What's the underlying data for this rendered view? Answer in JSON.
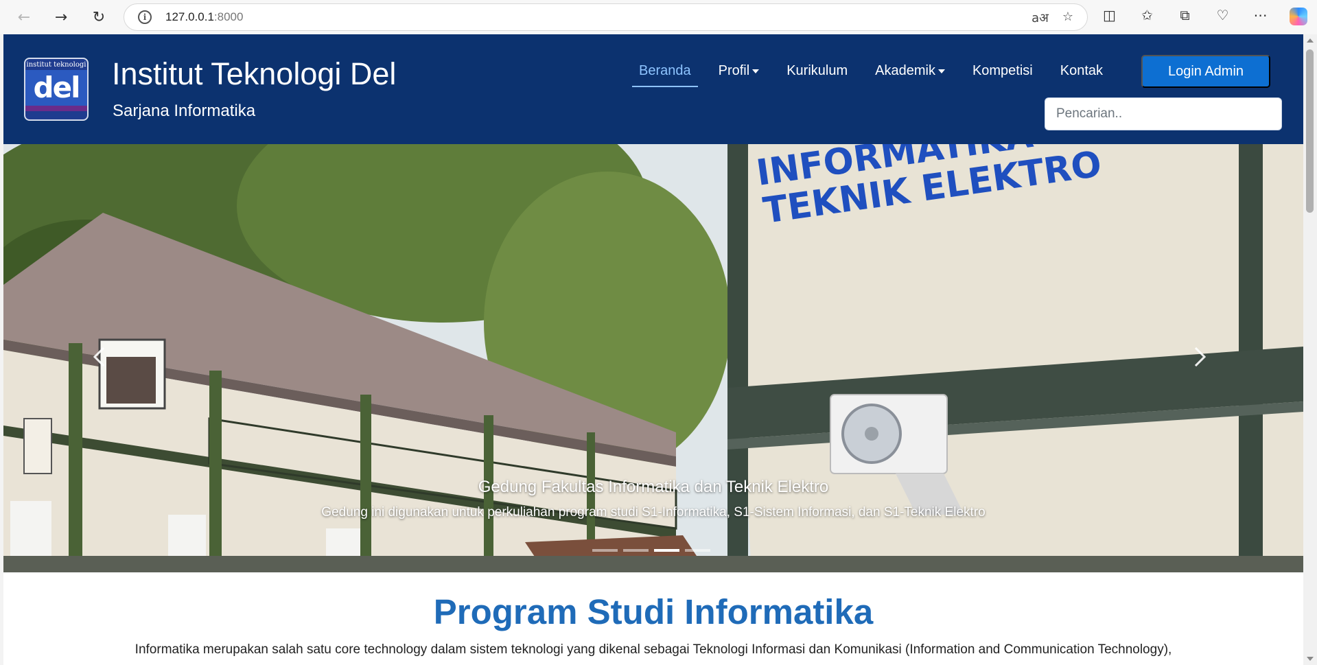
{
  "browser": {
    "url_host": "127.0.0.1",
    "url_port": ":8000",
    "icons": [
      "back-icon",
      "forward-icon",
      "refresh-icon",
      "site-info-icon",
      "read-aloud-icon",
      "favorite-star-icon",
      "split-screen-icon",
      "favorites-icon",
      "collections-icon",
      "browser-essentials-icon",
      "more-icon",
      "copilot-icon"
    ]
  },
  "header": {
    "logo_text": "institut teknologi",
    "logo_word": "del",
    "title": "Institut Teknologi Del",
    "subtitle": "Sarjana Informatika",
    "nav": [
      {
        "label": "Beranda",
        "active": true
      },
      {
        "label": "Profil",
        "dropdown": true
      },
      {
        "label": "Kurikulum"
      },
      {
        "label": "Akademik",
        "dropdown": true
      },
      {
        "label": "Kompetisi"
      },
      {
        "label": "Kontak"
      }
    ],
    "login_label": "Login Admin",
    "search_placeholder": "Pencarian.."
  },
  "carousel": {
    "caption_title": "Gedung Fakultas Informatika dan Teknik Elektro",
    "caption_text": "Gedung ini digunakan untuk perkuliahan program studi S1-Informatika, S1-Sistem Informasi, dan S1-Teknik Elektro",
    "building_sign_line1": "INFORMATIKA",
    "building_sign_line2": "TEKNIK ELEKTRO",
    "indicator_count": 4,
    "active_indicator": 3
  },
  "section": {
    "title": "Program Studi Informatika",
    "text": "Informatika merupakan salah satu core technology dalam sistem teknologi yang dikenal sebagai Teknologi Informasi dan Komunikasi (Information and Communication Technology),"
  },
  "colors": {
    "header_bg": "#0c326f",
    "active_nav": "#8ec4ff",
    "login_button": "#0d6fd2",
    "section_title": "#1f6bb8"
  }
}
